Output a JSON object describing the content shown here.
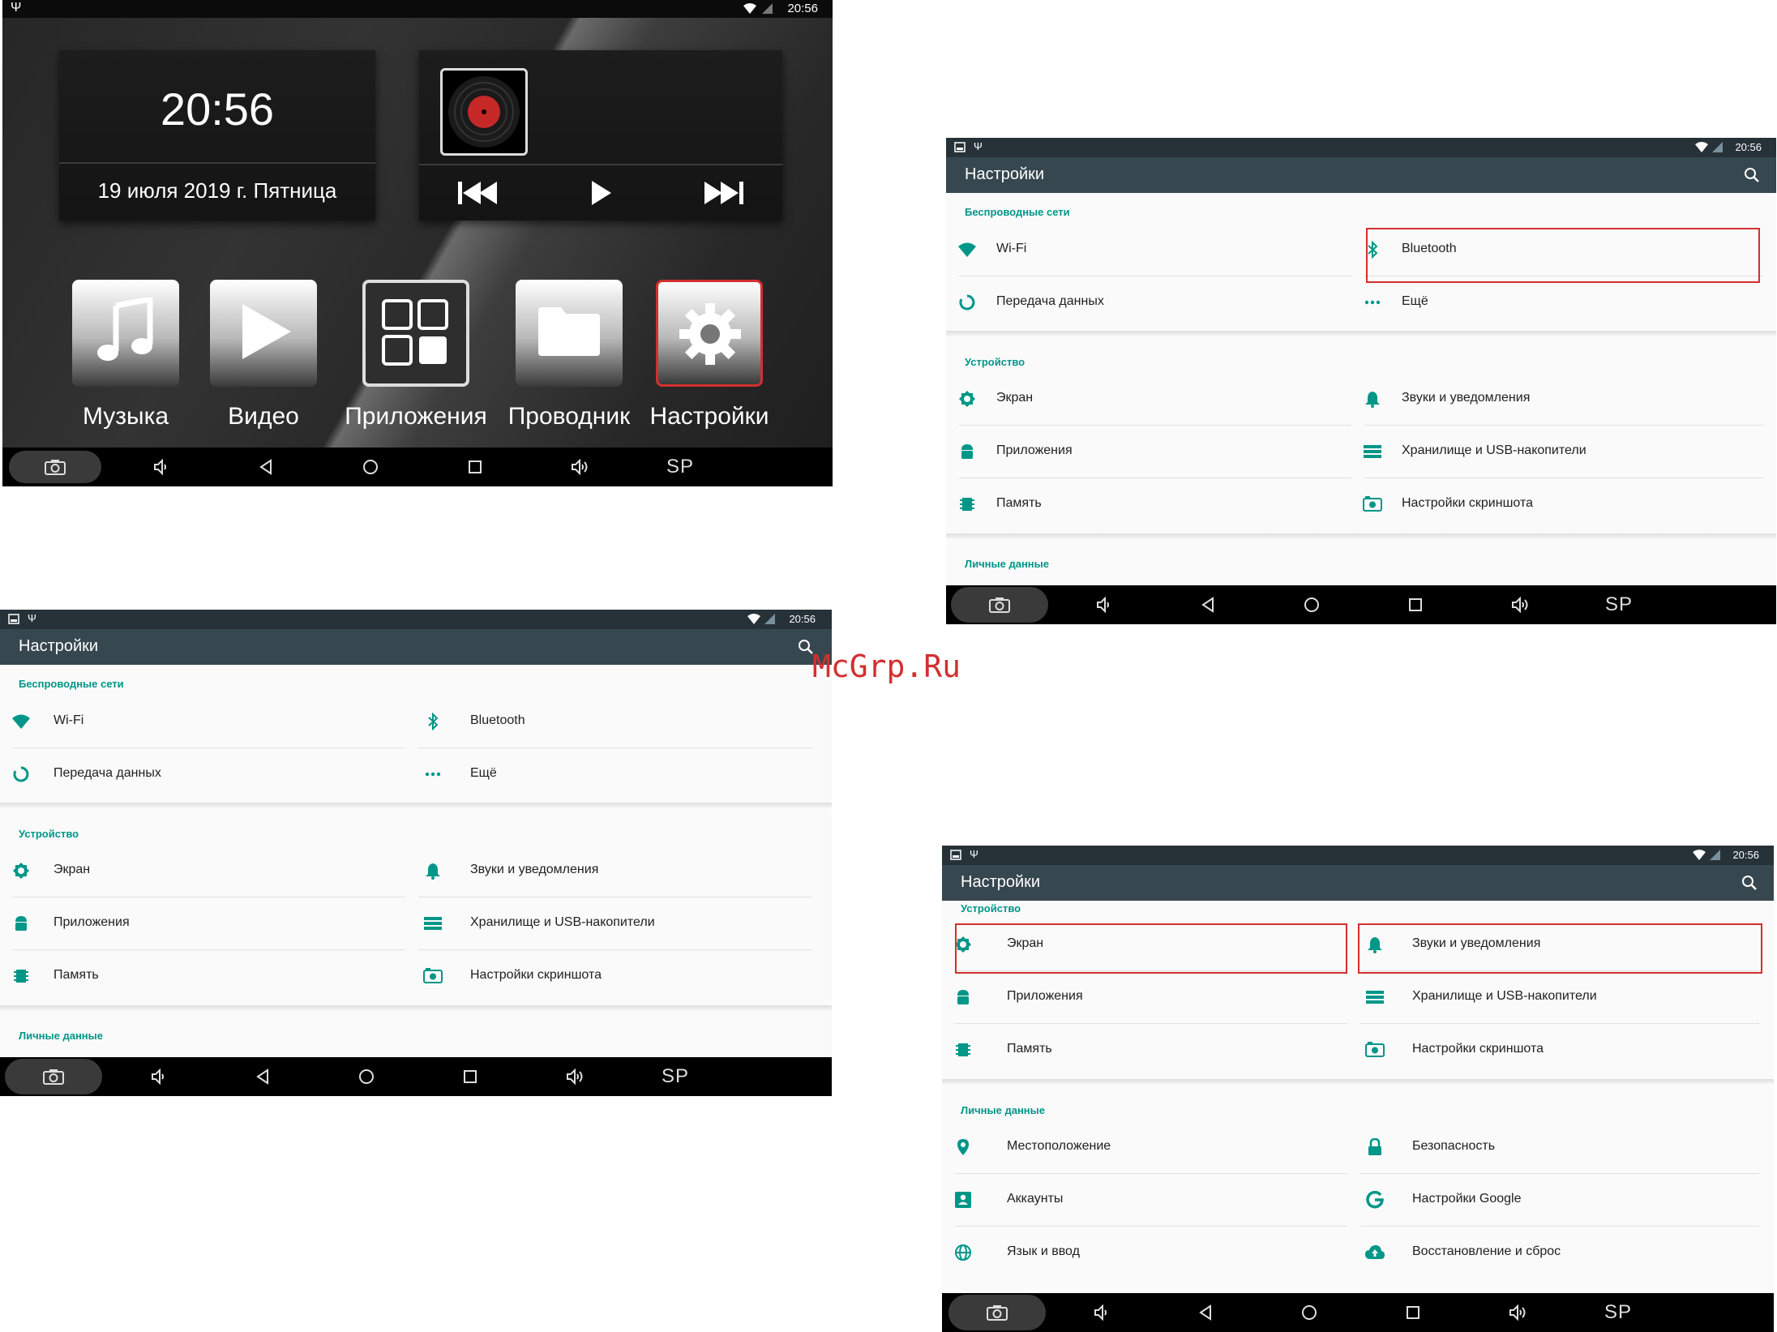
{
  "status": {
    "time": "20:56"
  },
  "home": {
    "clock": {
      "time": "20:56",
      "date": "19 июля 2019 г.  Пятница"
    },
    "apps": [
      {
        "label": "Музыка",
        "icon": "music-note-icon"
      },
      {
        "label": "Видео",
        "icon": "play-icon"
      },
      {
        "label": "Приложения",
        "icon": "apps-grid-icon"
      },
      {
        "label": "Проводник",
        "icon": "folder-icon"
      },
      {
        "label": "Настройки",
        "icon": "gear-icon",
        "highlighted": true
      }
    ]
  },
  "navbar": {
    "sp_label": "SP"
  },
  "settings": {
    "title": "Настройки",
    "sections": {
      "wireless": {
        "header": "Беспроводные сети",
        "items": [
          {
            "label": "Wi-Fi",
            "icon": "wifi-icon"
          },
          {
            "label": "Bluetooth",
            "icon": "bluetooth-icon"
          },
          {
            "label": "Передача данных",
            "icon": "data-usage-icon"
          },
          {
            "label": "Ещё",
            "icon": "more-dots-icon"
          }
        ]
      },
      "device": {
        "header": "Устройство",
        "items": [
          {
            "label": "Экран",
            "icon": "brightness-icon"
          },
          {
            "label": "Звуки и уведомления",
            "icon": "bell-icon"
          },
          {
            "label": "Приложения",
            "icon": "android-icon"
          },
          {
            "label": "Хранилище и USB-накопители",
            "icon": "storage-icon"
          },
          {
            "label": "Память",
            "icon": "memory-icon"
          },
          {
            "label": "Настройки скриншота",
            "icon": "screenshot-icon"
          }
        ]
      },
      "personal": {
        "header": "Личные данные",
        "items": [
          {
            "label": "Местоположение",
            "icon": "location-icon"
          },
          {
            "label": "Безопасность",
            "icon": "lock-icon"
          },
          {
            "label": "Аккаунты",
            "icon": "account-icon"
          },
          {
            "label": "Настройки Google",
            "icon": "google-icon"
          },
          {
            "label": "Язык и ввод",
            "icon": "globe-icon"
          },
          {
            "label": "Восстановление и сброс",
            "icon": "cloud-upload-icon"
          }
        ]
      }
    }
  },
  "colors": {
    "accent": "#009688",
    "highlight": "#d32f2f",
    "toolbar": "#37474f",
    "statusbar": "#263238"
  },
  "watermark": "McGrp.Ru"
}
